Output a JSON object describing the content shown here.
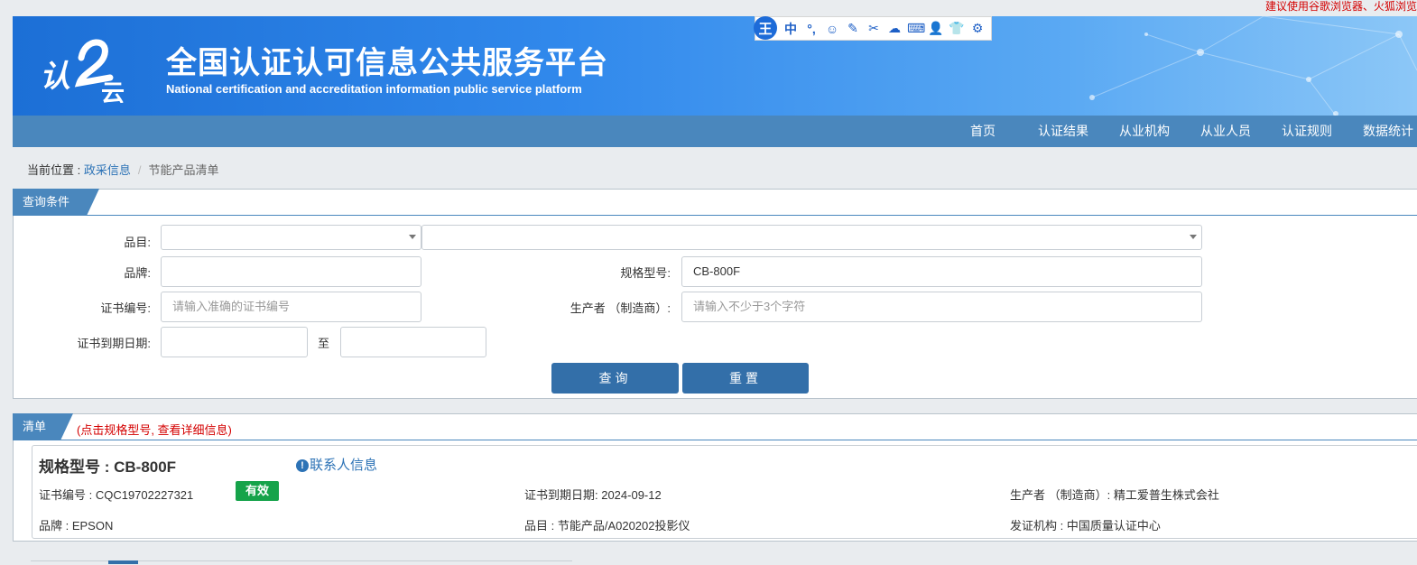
{
  "browser_note": "建议使用谷歌浏览器、火狐浏览",
  "header": {
    "title": "全国认证认可信息公共服务平台",
    "subtitle": "National certification and accreditation information public service platform",
    "logo_text": "认证云"
  },
  "ime": {
    "logo": "王",
    "items": [
      "中",
      "°,",
      "☺",
      "✎",
      "✂",
      "☁",
      "⌨",
      "👤",
      "👕",
      "⚙"
    ]
  },
  "nav": {
    "items": [
      "首页",
      "认证结果",
      "从业机构",
      "从业人员",
      "认证规则",
      "数据统计"
    ]
  },
  "breadcrumb": {
    "prefix": "当前位置 : ",
    "link": "政采信息",
    "separator": "/",
    "current": "节能产品清单"
  },
  "query": {
    "tab": "查询条件",
    "category_label": "品目:",
    "category_value_1": "",
    "category_value_2": "",
    "brand_label": "品牌:",
    "brand_value": "",
    "model_label": "规格型号:",
    "model_value": "CB-800F",
    "cert_no_label": "证书编号:",
    "cert_no_placeholder": "请输入准确的证书编号",
    "producer_label": "生产者 （制造商）:",
    "producer_placeholder": "请输入不少于3个字符",
    "expiry_label": "证书到期日期:",
    "expiry_from": "",
    "expiry_to_label": "至",
    "expiry_to": "",
    "search_button": "查询",
    "reset_button": "重置"
  },
  "list": {
    "tab": "清单",
    "hint": "(点击规格型号, 查看详细信息)",
    "item": {
      "model_title": "规格型号 : CB-800F",
      "contact_link": "联系人信息",
      "contact_icon": "!",
      "cert_no": "证书编号 : CQC19702227321",
      "status": "有效",
      "expiry": "证书到期日期: 2024-09-12",
      "producer": "生产者 （制造商）: 精工爱普生株式会社",
      "brand": "品牌 : EPSON",
      "category": "品目 : 节能产品/A020202投影仪",
      "issuer": "发证机构 : 中国质量认证中心"
    }
  },
  "colors": {
    "banner": "#2f86e8",
    "navbar": "#4a87bd",
    "button": "#336fa9",
    "status_valid": "#16a34a",
    "hint_red": "#d40000",
    "link": "#2d73b6"
  }
}
